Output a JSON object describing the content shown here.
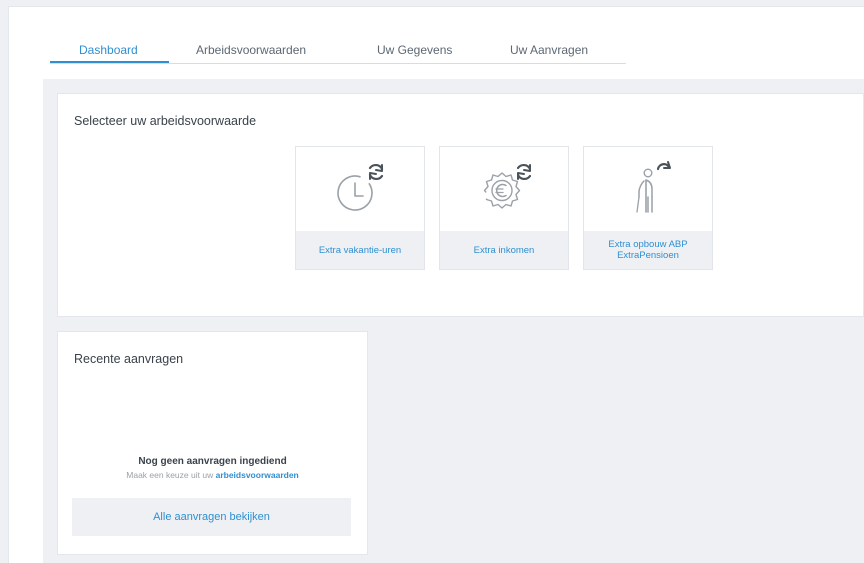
{
  "tabs": [
    {
      "label": "Dashboard",
      "active": true
    },
    {
      "label": "Arbeidsvoorwaarden",
      "active": false
    },
    {
      "label": "Uw Gegevens",
      "active": false
    },
    {
      "label": "Uw Aanvragen",
      "active": false
    }
  ],
  "select_panel": {
    "title": "Selecteer uw arbeidsvoorwaarde",
    "tiles": [
      {
        "label": "Extra vakantie-uren",
        "icon": "clock-refresh-icon"
      },
      {
        "label": "Extra inkomen",
        "icon": "euro-badge-refresh-icon"
      },
      {
        "label_line1": "Extra opbouw ABP",
        "label_line2": "ExtraPensioen",
        "icon": "elderly-person-refresh-icon"
      }
    ]
  },
  "recent_panel": {
    "title": "Recente aanvragen",
    "empty_title": "Nog geen aanvragen ingediend",
    "empty_sub_prefix": "Maak een keuze uit uw",
    "empty_sub_link": "arbeidsvoorwaarden",
    "button_label": "Alle aanvragen bekijken"
  },
  "colors": {
    "accent": "#2f8fd1",
    "text": "#3a424b",
    "muted": "#9aa1a8",
    "background": "#eef0f3",
    "icon_gray": "#9aa1a8",
    "refresh_icon": "#4a525a"
  }
}
